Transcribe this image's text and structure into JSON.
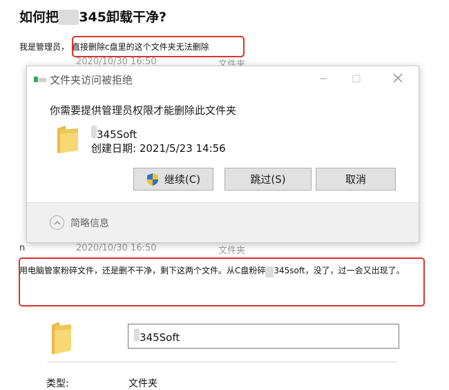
{
  "question": {
    "title_pre": "如何把",
    "title_hidden": "XX",
    "title_post": "345卸载干净?"
  },
  "paragraph1": {
    "lead": "我是管理员，",
    "highlight": "直接删除c盘里的这个文件夹无法删除"
  },
  "background_row1": {
    "date": "2020/10/30 16:50",
    "type": "文件夹"
  },
  "dialog": {
    "title": "文件夹访问被拒绝",
    "heading": "你需要提供管理员权限才能删除此文件夹",
    "file_name_hidden": "XX",
    "file_name": "345Soft",
    "created_label": "创建日期: 2021/5/23 14:56",
    "buttons": {
      "continue": "继续(C)",
      "skip": "跳过(S)",
      "cancel": "取消"
    },
    "details_label": "简略信息"
  },
  "background_row2": {
    "col1": "n",
    "date": "2020/10/30 16:50",
    "type": "文件夹"
  },
  "paragraph2": {
    "text_pre": "用电脑管家粉碎文件，还是删不干净，剩下这两个文件。从C盘粉碎",
    "text_hidden": "XX",
    "text_post": "345soft，没了，过一会又出现了。"
  },
  "properties": {
    "name_hidden": "XX",
    "name_value": "345Soft",
    "type_label": "类型:",
    "type_value": "文件夹"
  },
  "colors": {
    "highlight_border": "#d9342b",
    "folder_yellow": "#f8d775",
    "shield_blue": "#2a6fd6",
    "shield_yellow": "#f3c220"
  }
}
